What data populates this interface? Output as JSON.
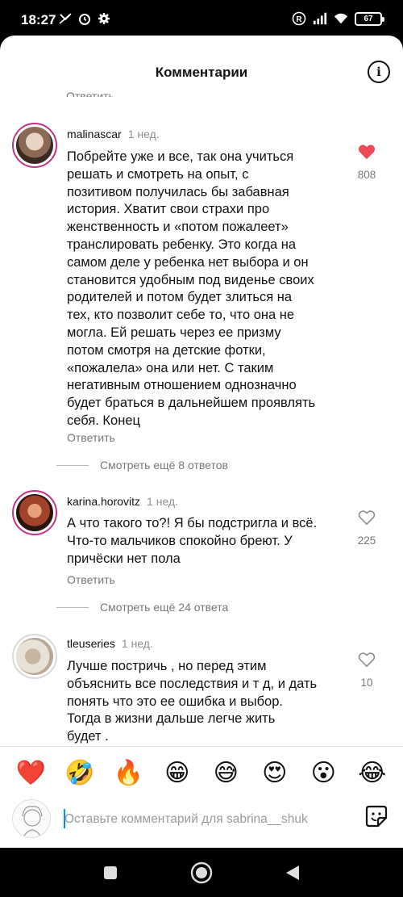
{
  "status_bar": {
    "time": "18:27",
    "battery": "67"
  },
  "header": {
    "title": "Комментарии"
  },
  "partial_reply": "Ответить",
  "comments": [
    {
      "username": "malinascar",
      "time": "1 нед.",
      "text": "Побрейте уже и все, так она учиться\nрешать и смотреть на опыт, с\nпозитивом получилась бы забавная\nистория. Хватит свои страхи про\nженственность и «потом пожалеет»\nтранслировать ребенку. Это когда на\nсамом деле у ребенка нет выбора и он\nстановится удобным под виденье своих\nродителей и потом будет злиться на\nтех, кто позволит себе то, что она не\nмогла. Ей решать через ее призму\nпотом смотря на детские фотки,\n«пожалела» она или нет. С таким\nнегативным отношением однозначно\nбудет браться в дальнейшем проявлять\nсебя. Конец",
      "reply_label": "Ответить",
      "likes": "808",
      "liked": true,
      "view_more": "Смотреть ещё 8 ответов"
    },
    {
      "username": "karina.horovitz",
      "time": "1 нед.",
      "text": "А что такого то?! Я бы подстригла и всё.\nЧто-то мальчиков спокойно бреют. У\nпричёски нет пола",
      "reply_label": "Ответить",
      "likes": "225",
      "liked": false,
      "view_more": "Смотреть ещё 24 ответа"
    },
    {
      "username": "tleuseries",
      "time": "1 нед.",
      "text": "Лучше постричь , но перед этим\nобъяснить все последствия и т д, и дать\nпонять что это ее ошибка и выбор.\nТогда в жизни дальше легче жить\nбудет .",
      "likes": "10",
      "liked": false
    }
  ],
  "emoji_bar": [
    "❤️",
    "🤣",
    "🔥",
    "😁",
    "😅",
    "😍",
    "😮",
    "😂"
  ],
  "comment_input": {
    "placeholder": "Оставьте комментарий для sabrina__shuk"
  },
  "colors": {
    "like_red": "#ed4956",
    "muted": "#8e8e8e",
    "story_ring": "#c13584"
  }
}
